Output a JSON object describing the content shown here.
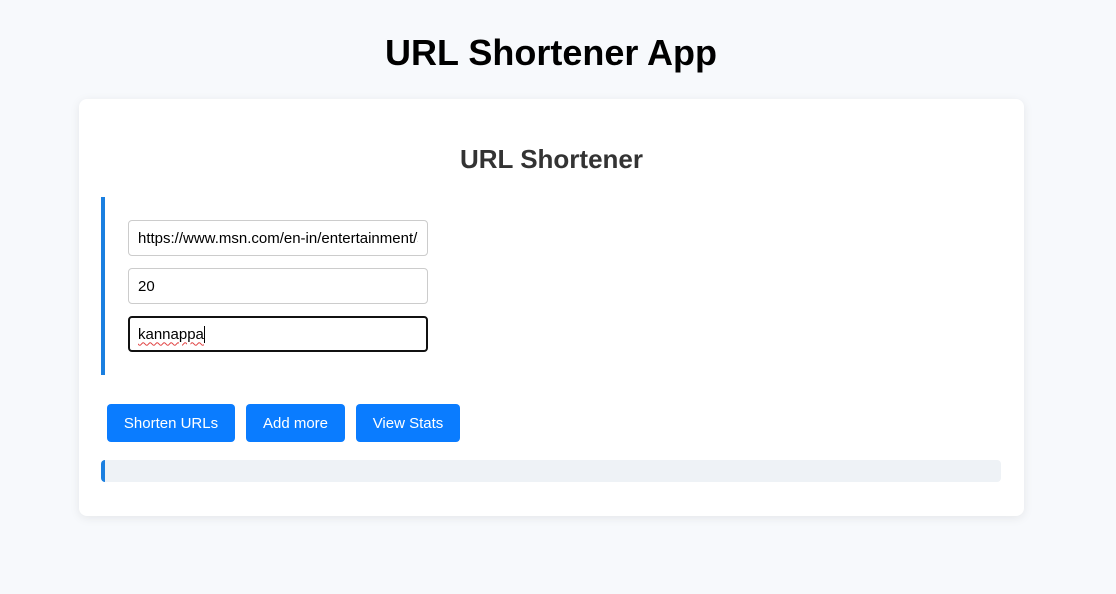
{
  "header": {
    "title": "URL Shortener App"
  },
  "card": {
    "title": "URL Shortener",
    "entry": {
      "url_value": "https://www.msn.com/en-in/entertainment/s",
      "validity_value": "20",
      "shortcode_value": "kannappa"
    },
    "buttons": {
      "shorten_label": "Shorten URLs",
      "add_more_label": "Add more",
      "view_stats_label": "View Stats"
    }
  },
  "colors": {
    "accent": "#0a7cff",
    "accent_border": "#1a7fe0",
    "page_bg": "#f7f9fc",
    "results_bg": "#eef2f6"
  }
}
